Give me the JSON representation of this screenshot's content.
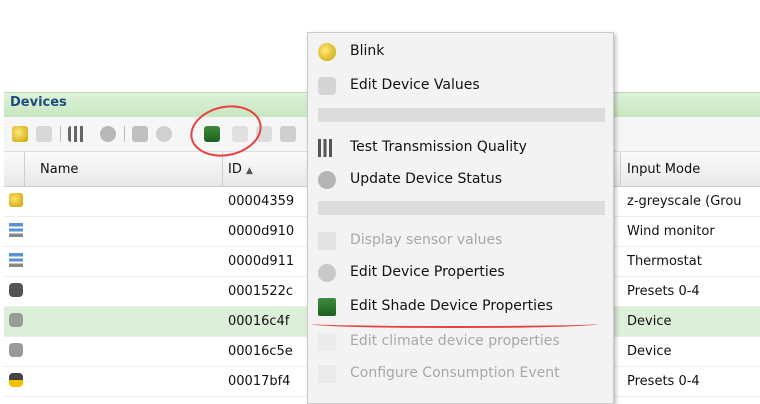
{
  "panel": {
    "title": "Devices"
  },
  "grid": {
    "columns": {
      "name": "Name",
      "id": "ID",
      "input_mode": "Input Mode"
    },
    "sort_indicator": "▲",
    "rows": [
      {
        "icon": "light-bulb-icon",
        "id": "00004359",
        "mode": "z-greyscale (Grou"
      },
      {
        "icon": "antenna-icon",
        "id": "0000d910",
        "mode": "Wind monitor"
      },
      {
        "icon": "antenna-icon",
        "id": "0000d911",
        "mode": "Thermostat"
      },
      {
        "icon": "device-dark-icon",
        "id": "0001522c",
        "mode": "Presets 0-4"
      },
      {
        "icon": "device-grey-icon",
        "id": "00016c4f",
        "mode": "Device",
        "selected": true
      },
      {
        "icon": "device-grey-icon",
        "id": "00016c5e",
        "mode": "Device"
      },
      {
        "icon": "device-yellow-icon",
        "id": "00017bf4",
        "mode": "Presets 0-4"
      }
    ]
  },
  "menu": {
    "items": [
      {
        "label": "Blink",
        "icon": "bulb-icon",
        "enabled": true
      },
      {
        "label": "Edit Device Values",
        "icon": "edit-values-icon",
        "enabled": true
      },
      {
        "label": "Test Transmission Quality",
        "icon": "signal-bars-icon",
        "enabled": true
      },
      {
        "label": "Update Device Status",
        "icon": "refresh-status-icon",
        "enabled": true
      },
      {
        "label": "Display sensor values",
        "icon": "sensor-icon",
        "enabled": false
      },
      {
        "label": "Edit Device Properties",
        "icon": "gear-icon",
        "enabled": true
      },
      {
        "label": "Edit Shade Device Properties",
        "icon": "shade-gear-icon",
        "enabled": true
      },
      {
        "label": "Edit climate device properties",
        "icon": "climate-icon",
        "enabled": false
      },
      {
        "label": "Configure Consumption Event",
        "icon": "consumption-icon",
        "enabled": false
      }
    ]
  },
  "colors": {
    "header_green": "#c7e6bf",
    "selected_row": "#dcefd8",
    "annotation_red": "#e64040",
    "title_blue": "#1f4d7d"
  }
}
